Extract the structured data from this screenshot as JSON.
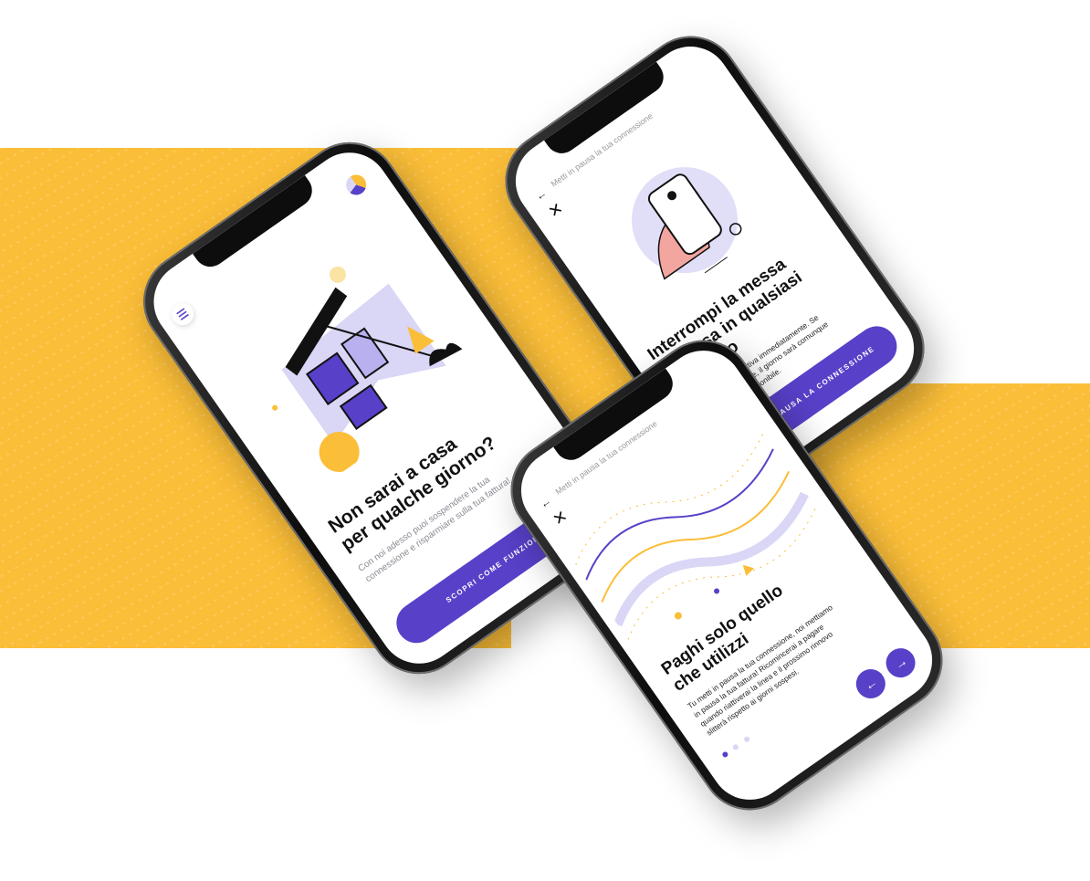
{
  "colors": {
    "accent": "#5840C8",
    "yellow": "#FBBE38",
    "lavender": "#D9D6F6"
  },
  "screen1": {
    "title_line1": "Non sarai a casa",
    "title_line2": "per qualche giorno?",
    "body_line1": "Con noi adesso puoi sospendere la tua",
    "body_line2": "connessione e risparmiare sulla tua fattura!",
    "cta_label": "SCOPRI COME FUNZIONA",
    "menu_icon": "hamburger-menu-icon"
  },
  "screen2": {
    "header_title": "Metti in pausa la tua connessione",
    "title_line1": "Interrompi la messa",
    "title_line2": "in pausa in qualsiasi",
    "title_line3": "momento",
    "body_line1": "La connessione si riattiva immediatamente. Se",
    "body_line2": "riattivi anticipatamente, il giorno sarà comunque",
    "body_line3": "scalato dal totale disponibile.",
    "cta_label": "METTI IN PAUSA LA CONNESSIONE",
    "back_icon": "back-arrow-icon",
    "close_icon": "close-icon"
  },
  "screen3": {
    "header_title": "Metti in pausa la tua connessione",
    "title_line1": "Paghi solo quello",
    "title_line2": "che utilizzi",
    "body_line1": "Tu metti in pausa la tua connessione, noi mettiamo",
    "body_line2": "in pausa la tua fattura! Ricomincerai a pagare",
    "body_line3": "quando riattiverai la linea e il prossimo rinnovo",
    "body_line4": "slitterà rispetto ai giorni sospesi.",
    "prev_label": "←",
    "next_label": "→",
    "back_icon": "back-arrow-icon",
    "close_icon": "close-icon"
  }
}
